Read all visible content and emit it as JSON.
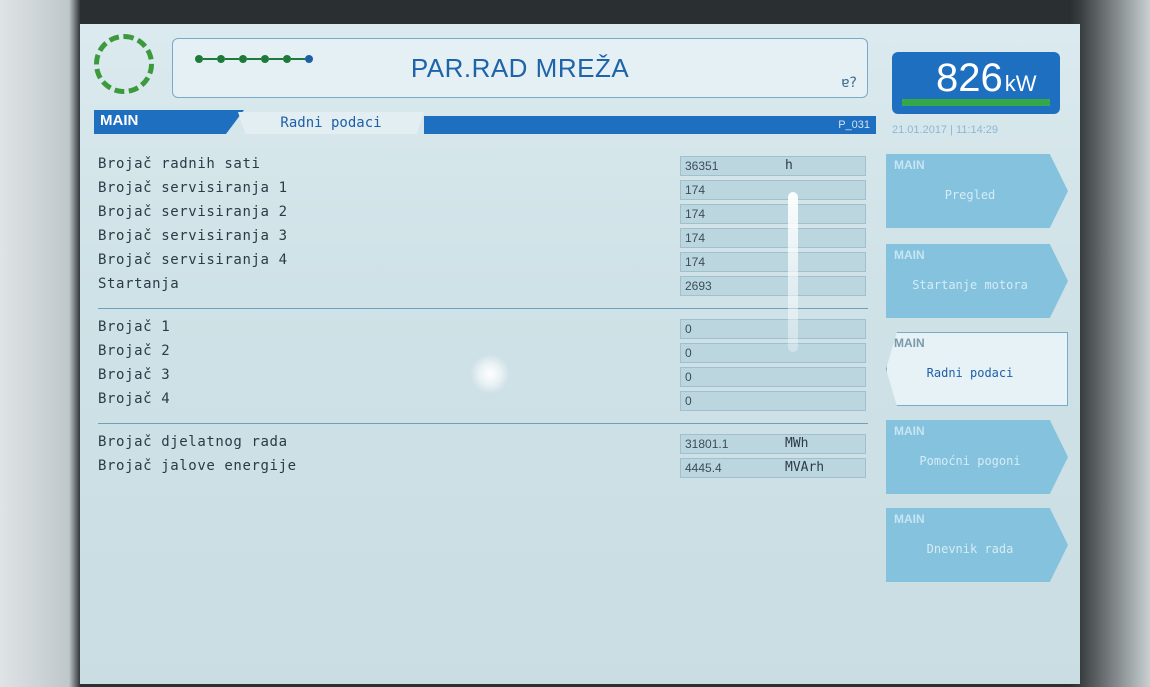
{
  "header": {
    "title": "PAR.RAD MREŽA",
    "lock_symbol": "ɐ?"
  },
  "power": {
    "value": "826",
    "unit": "kW",
    "level_fraction": 1.0
  },
  "tabs": {
    "main": "MAIN",
    "active": "Radni podaci",
    "page_code": "P_031"
  },
  "datetime": "21.01.2017 | 11:14:29",
  "groups": [
    {
      "rows": [
        {
          "label": "Brojač radnih sati",
          "value": "36351",
          "unit": "h"
        },
        {
          "label": "Brojač servisiranja 1",
          "value": "174",
          "unit": ""
        },
        {
          "label": "Brojač servisiranja 2",
          "value": "174",
          "unit": ""
        },
        {
          "label": "Brojač servisiranja 3",
          "value": "174",
          "unit": ""
        },
        {
          "label": "Brojač servisiranja 4",
          "value": "174",
          "unit": ""
        },
        {
          "label": "Startanja",
          "value": "2693",
          "unit": ""
        }
      ]
    },
    {
      "rows": [
        {
          "label": "Brojač 1",
          "value": "0",
          "unit": ""
        },
        {
          "label": "Brojač 2",
          "value": "0",
          "unit": ""
        },
        {
          "label": "Brojač 3",
          "value": "0",
          "unit": ""
        },
        {
          "label": "Brojač 4",
          "value": "0",
          "unit": ""
        }
      ]
    },
    {
      "rows": [
        {
          "label": "Brojač djelatnog rada",
          "value": "31801.1",
          "unit": "MWh"
        },
        {
          "label": "Brojač jalove energije",
          "value": "4445.4",
          "unit": "MVArh"
        }
      ]
    }
  ],
  "menu": [
    {
      "group": "MAIN",
      "label": "Pregled",
      "active": false
    },
    {
      "group": "MAIN",
      "label": "Startanje motora",
      "active": false
    },
    {
      "group": "MAIN",
      "label": "Radni podaci",
      "active": true
    },
    {
      "group": "MAIN",
      "label": "Pomoćni pogoni",
      "active": false
    },
    {
      "group": "MAIN",
      "label": "Dnevnik rada",
      "active": false
    }
  ]
}
